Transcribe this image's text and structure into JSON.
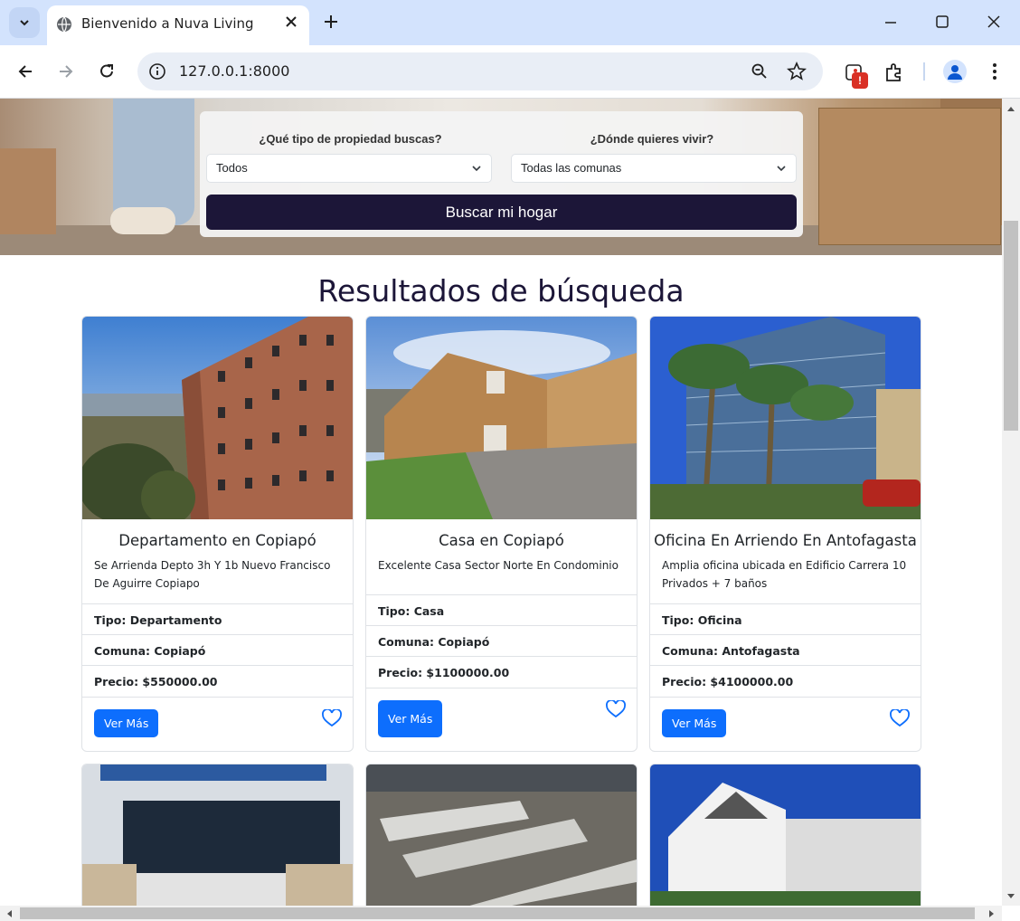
{
  "browser": {
    "tab_title": "Bienvenido a Nuva Living",
    "url": "127.0.0.1:8000",
    "extension_badge": "!"
  },
  "search": {
    "type_label": "¿Qué tipo de propiedad buscas?",
    "type_value": "Todos",
    "location_label": "¿Dónde quieres vivir?",
    "location_value": "Todas las comunas",
    "button_label": "Buscar mi hogar"
  },
  "results": {
    "title": "Resultados de búsqueda",
    "cards": [
      {
        "title": "Departamento en Copiapó",
        "description": "Se Arrienda Depto 3h Y 1b Nuevo Francisco De Aguirre Copiapo",
        "tipo": "Tipo: Departamento",
        "comuna": "Comuna: Copiapó",
        "precio": "Precio: $550000.00",
        "button": "Ver Más"
      },
      {
        "title": "Casa en Copiapó",
        "description": "Excelente Casa Sector Norte En Condominio",
        "tipo": "Tipo: Casa",
        "comuna": "Comuna: Copiapó",
        "precio": "Precio: $1100000.00",
        "button": "Ver Más"
      },
      {
        "title": "Oficina En Arriendo En Antofagasta",
        "description": "Amplia oficina ubicada en Edificio Carrera 10 Privados + 7 baños",
        "tipo": "Tipo: Oficina",
        "comuna": "Comuna: Antofagasta",
        "precio": "Precio: $4100000.00",
        "button": "Ver Más"
      }
    ]
  },
  "colors": {
    "brand_dark": "#1c1638",
    "primary_button": "#0d6efd",
    "heart": "#0d6efd"
  }
}
